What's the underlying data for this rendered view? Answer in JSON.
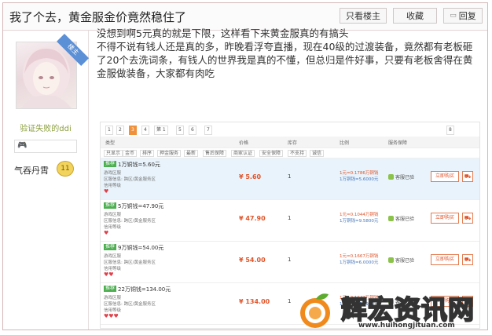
{
  "thread": {
    "title": "我了个去，黄金服金价竟然稳住了",
    "only_op_label": "只看楼主",
    "favorite_label": "收藏",
    "reply_label": "回复"
  },
  "author": {
    "floor_badge": "楼主",
    "username": "验证失败的ddi",
    "rank": "气吞丹霄",
    "level": "11"
  },
  "post": {
    "line1": "没想到啊5元真的就是下限，这样看下来黄金服真的有搞头",
    "line2": "不得不说有钱人还是真的多，昨晚看浮夸直播，现在40级的过渡装备，竟然都有老板砸了20个去洗词条，有钱人的世界我是真的不懂，但总归是件好事，只要有老板舍得在黄金服做装备，大家都有肉吃"
  },
  "screenshot": {
    "pager": [
      "1",
      "2",
      "3",
      "4",
      "5",
      "6",
      "7",
      "8"
    ],
    "pager_active": "第 1",
    "headers": [
      "类型",
      "价格",
      "库存",
      "比例",
      "服务保障"
    ],
    "filters": [
      "只显示",
      "金币",
      "排序",
      "押金服务",
      "最新",
      "售后保障",
      "商家认证",
      "安全保障",
      "不支持",
      "诚信"
    ],
    "rows": [
      {
        "tag": "推荐",
        "title": "1万铜钱=5.60元",
        "line_a": "游戏区服",
        "line_b": "区服信息: 跨区/黄金服务区",
        "line_c": "信用等级",
        "price": "¥ 5.60",
        "qty": "1",
        "ratio_a": "1元=0.1786万铜钱",
        "ratio_b": "1万铜钱=5.6000元",
        "safe": "客服已验",
        "buy": "立即购买",
        "hearts": "♥"
      },
      {
        "tag": "推荐",
        "title": "5万铜钱=47.90元",
        "line_a": "游戏区服",
        "line_b": "区服信息: 跨区/黄金服务区",
        "line_c": "信用等级",
        "price": "¥ 47.90",
        "qty": "1",
        "ratio_a": "1元=0.1044万铜钱",
        "ratio_b": "1万铜钱=9.5800元",
        "safe": "客服已验",
        "buy": "立即购买",
        "hearts": "♥"
      },
      {
        "tag": "推荐",
        "title": "9万铜钱=54.00元",
        "line_a": "游戏区服",
        "line_b": "区服信息: 跨区/黄金服务区",
        "line_c": "信用等级",
        "price": "¥ 54.00",
        "qty": "1",
        "ratio_a": "1元=0.1667万铜钱",
        "ratio_b": "1万铜钱=6.0000元",
        "safe": "客服已验",
        "buy": "立即购买",
        "hearts": "♥♥"
      },
      {
        "tag": "推荐",
        "title": "22万铜钱=134.00元",
        "line_a": "游戏区服",
        "line_b": "区服信息: 跨区/黄金服务区",
        "line_c": "信用等级",
        "price": "¥ 134.00",
        "qty": "1",
        "ratio_a": "1元=0.1642万铜钱",
        "ratio_b": "1万铜钱=6.0909元",
        "safe": "客服已验",
        "buy": "立即购买",
        "hearts": "♥♥♥"
      }
    ]
  },
  "watermark": {
    "text": "辉宏资讯网",
    "url": "www.huihongjituan.com"
  }
}
